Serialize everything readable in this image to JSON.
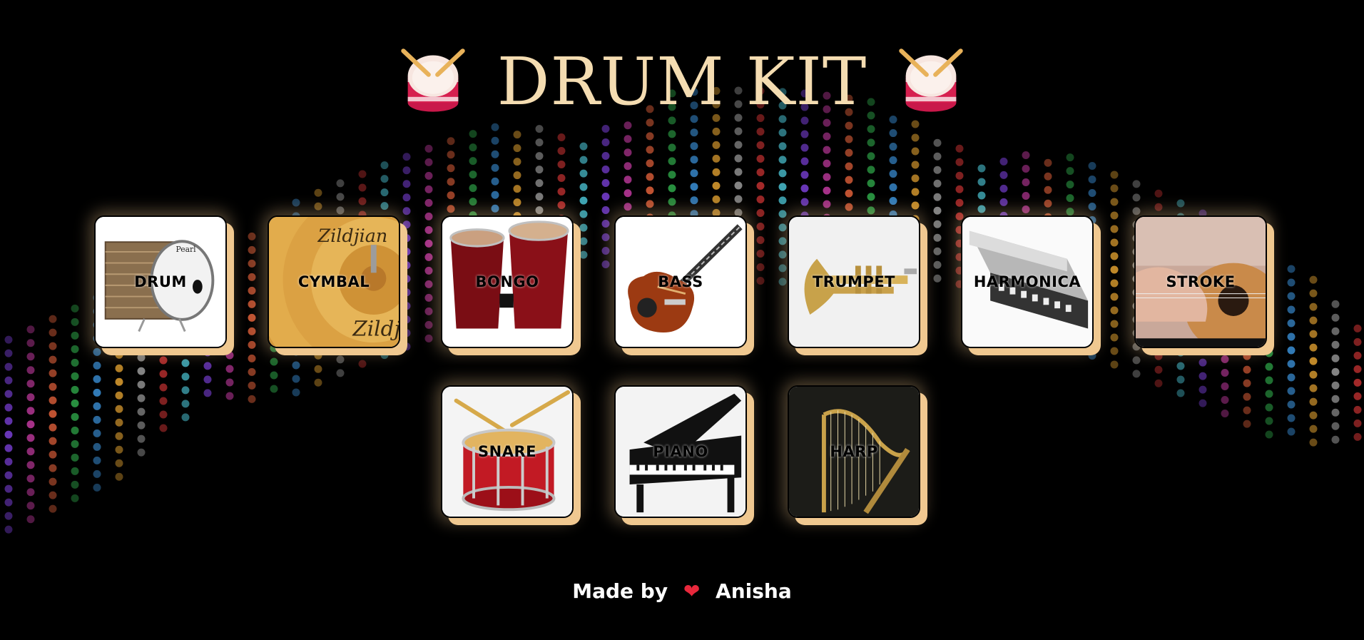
{
  "title": "DRUM KIT",
  "title_icon": "drum-emoji",
  "keys": [
    {
      "label": "DRUM",
      "image": "bass-drum"
    },
    {
      "label": "CYMBAL",
      "image": "cymbal"
    },
    {
      "label": "BONGO",
      "image": "bongo-drums"
    },
    {
      "label": "BASS",
      "image": "bass-guitar"
    },
    {
      "label": "TRUMPET",
      "image": "trumpet"
    },
    {
      "label": "HARMONICA",
      "image": "harmonica"
    },
    {
      "label": "STROKE",
      "image": "acoustic-guitar"
    },
    {
      "label": "SNARE",
      "image": "snare-drum"
    },
    {
      "label": "PIANO",
      "image": "grand-piano"
    },
    {
      "label": "HARP",
      "image": "harp"
    }
  ],
  "footer": {
    "prefix": "Made by",
    "heart_icon": "heart-icon",
    "author": "Anisha"
  },
  "colors": {
    "background": "#000000",
    "title": "#f4dcb1",
    "key_shadow": "#f0c890",
    "heart": "#e8283c"
  }
}
